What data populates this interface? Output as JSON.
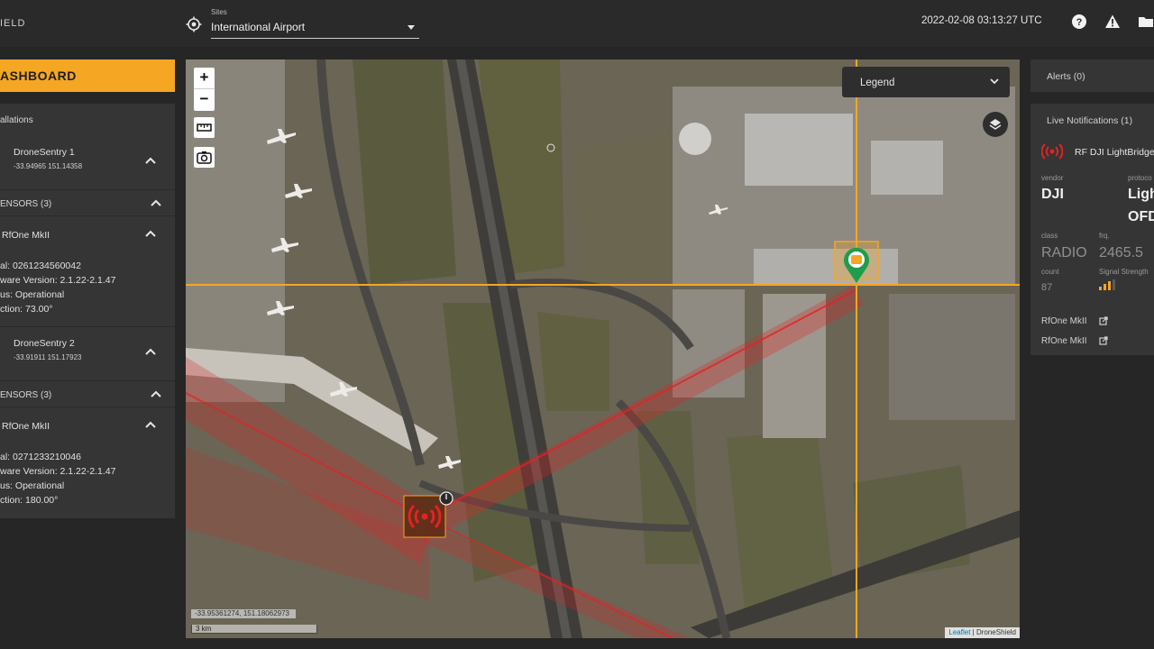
{
  "header": {
    "brand": "IELD",
    "site_label": "Sites",
    "site_value": "International Airport",
    "datetime": "2022-02-08 03:13:27 UTC",
    "icons": [
      "help-icon",
      "warning-icon",
      "folder-icon",
      "crosshair-icon"
    ]
  },
  "sidebar": {
    "dashboard_label": "ASHBOARD",
    "installations_header": "allations",
    "installations": [
      {
        "name": "DroneSentry 1",
        "coords": "-33.94965 151.14358",
        "sensors_header": "ENSORS (3)",
        "sensor_name": "RfOne MkII",
        "serial": "al: 0261234560042",
        "firmware": "ware Version: 2.1.22-2.1.47",
        "status": "us: Operational",
        "direction": "ction: 73.00°"
      },
      {
        "name": "DroneSentry 2",
        "coords": "-33.91911 151.17923",
        "sensors_header": "ENSORS (3)",
        "sensor_name": "RfOne MkII",
        "serial": "al: 0271233210046",
        "firmware": "ware Version: 2.1.22-2.1.47",
        "status": "us: Operational",
        "direction": "ction: 180.00°"
      }
    ]
  },
  "map": {
    "zoom_in": "+",
    "zoom_out": "−",
    "legend_label": "Legend",
    "coords_readout": "-33.95361274, 151.18062973",
    "scale_label": "3 km",
    "attribution_link": "Leaflet",
    "attribution_rest": " | DroneShield"
  },
  "alerts": {
    "label": "Alerts (0)"
  },
  "notifications": {
    "title": "Live Notifications (1)",
    "detection": "RF DJI LightBridge",
    "vendor_label": "vendor",
    "vendor_value": "DJI",
    "protocol_label": "protoco",
    "protocol_value_1": "Ligh",
    "protocol_value_2": "OFD",
    "class_label": "class",
    "class_value": "RADIO",
    "freq_label": "frq.",
    "freq_value": "2465.5",
    "count_label": "count",
    "count_value": "87",
    "signal_label": "Signal Strength",
    "signal_level": 0.75,
    "sensors": [
      "RfOne MkII",
      "RfOne MkII"
    ]
  },
  "colors": {
    "accent": "#f5a623",
    "rf_red": "#e02424",
    "drone_green": "#1f9d4c",
    "panel": "#353535",
    "background": "#262626"
  }
}
